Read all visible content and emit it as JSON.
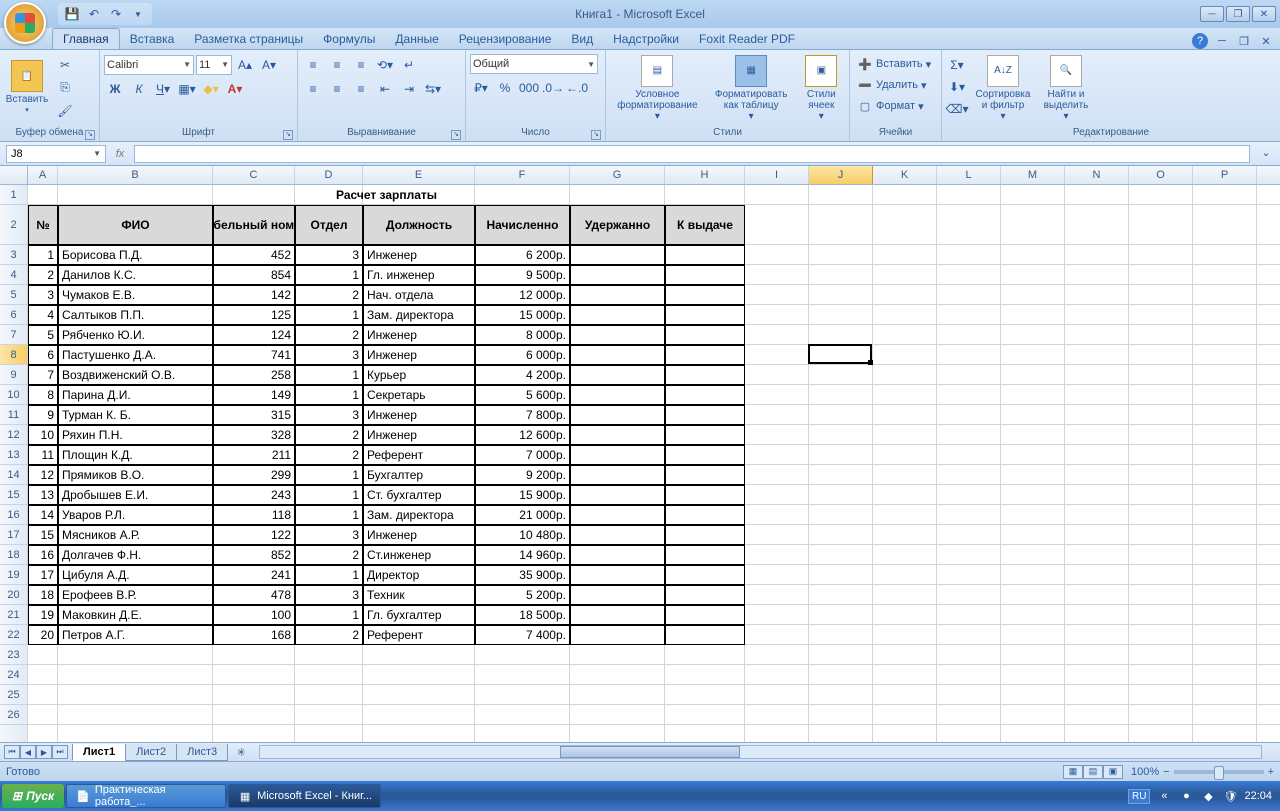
{
  "title": "Книга1 - Microsoft Excel",
  "qat": {
    "save": "💾",
    "undo": "↶",
    "redo": "↷"
  },
  "tabs": [
    "Главная",
    "Вставка",
    "Разметка страницы",
    "Формулы",
    "Данные",
    "Рецензирование",
    "Вид",
    "Надстройки",
    "Foxit Reader PDF"
  ],
  "activeTab": 0,
  "ribbon": {
    "clipboard": {
      "label": "Буфер обмена",
      "paste": "Вставить"
    },
    "font": {
      "label": "Шрифт",
      "name": "Calibri",
      "size": "11"
    },
    "align": {
      "label": "Выравнивание"
    },
    "number": {
      "label": "Число",
      "format": "Общий"
    },
    "styles": {
      "label": "Стили",
      "cond": "Условное форматирование",
      "table": "Форматировать как таблицу",
      "cell": "Стили ячеек"
    },
    "cells": {
      "label": "Ячейки",
      "insert": "Вставить",
      "delete": "Удалить",
      "format": "Формат"
    },
    "editing": {
      "label": "Редактирование",
      "sort": "Сортировка и фильтр",
      "find": "Найти и выделить"
    }
  },
  "namebox": "J8",
  "formula": "",
  "columns": [
    {
      "l": "A",
      "w": 30
    },
    {
      "l": "B",
      "w": 155
    },
    {
      "l": "C",
      "w": 82
    },
    {
      "l": "D",
      "w": 68
    },
    {
      "l": "E",
      "w": 112
    },
    {
      "l": "F",
      "w": 95
    },
    {
      "l": "G",
      "w": 95
    },
    {
      "l": "H",
      "w": 80
    },
    {
      "l": "I",
      "w": 64
    },
    {
      "l": "J",
      "w": 64
    },
    {
      "l": "K",
      "w": 64
    },
    {
      "l": "L",
      "w": 64
    },
    {
      "l": "M",
      "w": 64
    },
    {
      "l": "N",
      "w": 64
    },
    {
      "l": "O",
      "w": 64
    },
    {
      "l": "P",
      "w": 64
    }
  ],
  "rowCount": 26,
  "selectedCell": {
    "col": 9,
    "row": 7
  },
  "tableTitle": "Расчет зарплаты",
  "headers": [
    "№",
    "ФИО",
    "Табельный номер",
    "Отдел",
    "Должность",
    "Начисленно",
    "Удержанно",
    "К выдаче"
  ],
  "rows": [
    {
      "n": 1,
      "fio": "Борисова П.Д.",
      "tab": 452,
      "dep": 3,
      "pos": "Инженер",
      "sum": "6 200р."
    },
    {
      "n": 2,
      "fio": "Данилов К.С.",
      "tab": 854,
      "dep": 1,
      "pos": "Гл. инженер",
      "sum": "9 500р."
    },
    {
      "n": 3,
      "fio": "Чумаков Е.В.",
      "tab": 142,
      "dep": 2,
      "pos": "Нач. отдела",
      "sum": "12 000р."
    },
    {
      "n": 4,
      "fio": "Салтыков П.П.",
      "tab": 125,
      "dep": 1,
      "pos": "Зам. директора",
      "sum": "15 000р."
    },
    {
      "n": 5,
      "fio": "Рябченко Ю.И.",
      "tab": 124,
      "dep": 2,
      "pos": "Инженер",
      "sum": "8 000р."
    },
    {
      "n": 6,
      "fio": "Пастушенко Д.А.",
      "tab": 741,
      "dep": 3,
      "pos": "Инженер",
      "sum": "6 000р."
    },
    {
      "n": 7,
      "fio": "Воздвиженский О.В.",
      "tab": 258,
      "dep": 1,
      "pos": "Курьер",
      "sum": "4 200р."
    },
    {
      "n": 8,
      "fio": "Парина Д.И.",
      "tab": 149,
      "dep": 1,
      "pos": "Секретарь",
      "sum": "5 600р."
    },
    {
      "n": 9,
      "fio": "Турман К. Б.",
      "tab": 315,
      "dep": 3,
      "pos": "Инженер",
      "sum": "7 800р."
    },
    {
      "n": 10,
      "fio": "Ряхин П.Н.",
      "tab": 328,
      "dep": 2,
      "pos": "Инженер",
      "sum": "12 600р."
    },
    {
      "n": 11,
      "fio": "Площин К.Д.",
      "tab": 211,
      "dep": 2,
      "pos": "Референт",
      "sum": "7 000р."
    },
    {
      "n": 12,
      "fio": "Прямиков В.О.",
      "tab": 299,
      "dep": 1,
      "pos": "Бухгалтер",
      "sum": "9 200р."
    },
    {
      "n": 13,
      "fio": "Дробышев Е.И.",
      "tab": 243,
      "dep": 1,
      "pos": "Ст. бухгалтер",
      "sum": "15 900р."
    },
    {
      "n": 14,
      "fio": "Уваров Р.Л.",
      "tab": 118,
      "dep": 1,
      "pos": "Зам. директора",
      "sum": "21 000р."
    },
    {
      "n": 15,
      "fio": "Мясников А.Р.",
      "tab": 122,
      "dep": 3,
      "pos": "Инженер",
      "sum": "10 480р."
    },
    {
      "n": 16,
      "fio": "Долгачев Ф.Н.",
      "tab": 852,
      "dep": 2,
      "pos": "Ст.инженер",
      "sum": "14 960р."
    },
    {
      "n": 17,
      "fio": "Цибуля А.Д.",
      "tab": 241,
      "dep": 1,
      "pos": "Директор",
      "sum": "35 900р."
    },
    {
      "n": 18,
      "fio": "Ерофеев В.Р.",
      "tab": 478,
      "dep": 3,
      "pos": "Техник",
      "sum": "5 200р."
    },
    {
      "n": 19,
      "fio": "Маковкин Д.Е.",
      "tab": 100,
      "dep": 1,
      "pos": "Гл. бухгалтер",
      "sum": "18 500р."
    },
    {
      "n": 20,
      "fio": "Петров А.Г.",
      "tab": 168,
      "dep": 2,
      "pos": "Референт",
      "sum": "7 400р."
    }
  ],
  "sheets": [
    "Лист1",
    "Лист2",
    "Лист3"
  ],
  "activeSheet": 0,
  "status": "Готово",
  "zoom": "100%",
  "taskbar": {
    "start": "Пуск",
    "items": [
      "Практическая работа_...",
      "Microsoft Excel - Книг..."
    ],
    "activeItem": 1,
    "lang": "RU",
    "time": "22:04"
  }
}
